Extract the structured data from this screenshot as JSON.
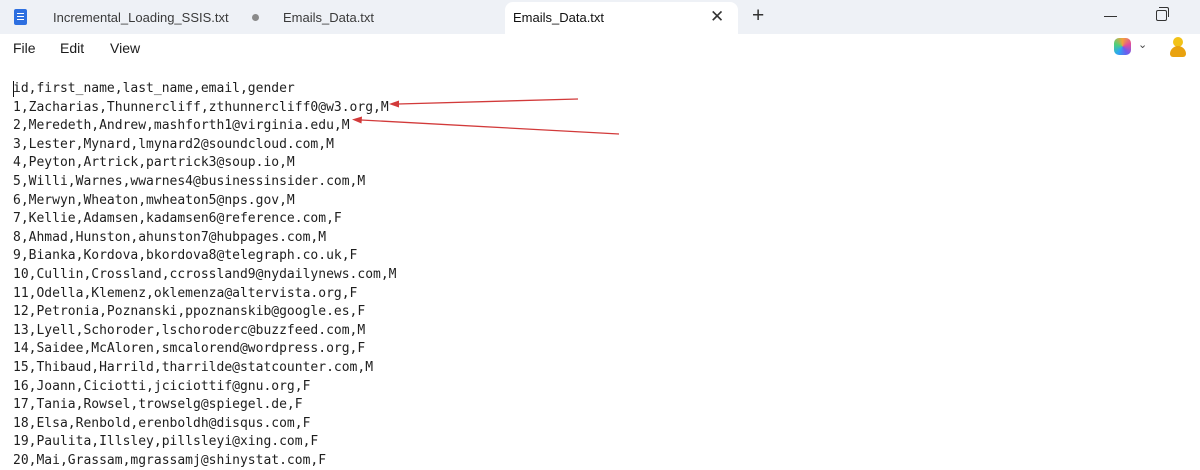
{
  "tabs": [
    {
      "label": "Incremental_Loading_SSIS.txt",
      "modified": true
    },
    {
      "label": "Emails_Data.txt"
    },
    {
      "label": "Emails_Data.txt",
      "active": true
    }
  ],
  "menu": [
    "File",
    "Edit",
    "View"
  ],
  "colors": {
    "annotation_arrow": "#d23a3a",
    "tab_accent": "#2d6fe0"
  },
  "icons": [
    "notepad-icon",
    "unsaved-dot-icon",
    "close-icon",
    "plus-icon",
    "minimize-icon",
    "maximize-icon",
    "copilot-icon",
    "chevron-down-icon",
    "avatar-icon"
  ],
  "file_lines": [
    "id,first_name,last_name,email,gender",
    "1,Zacharias,Thunnercliff,zthunnercliff0@w3.org,M",
    "2,Meredeth,Andrew,mashforth1@virginia.edu,M",
    "3,Lester,Mynard,lmynard2@soundcloud.com,M",
    "4,Peyton,Artrick,partrick3@soup.io,M",
    "5,Willi,Warnes,wwarnes4@businessinsider.com,M",
    "6,Merwyn,Wheaton,mwheaton5@nps.gov,M",
    "7,Kellie,Adamsen,kadamsen6@reference.com,F",
    "8,Ahmad,Hunston,ahunston7@hubpages.com,M",
    "9,Bianka,Kordova,bkordova8@telegraph.co.uk,F",
    "10,Cullin,Crossland,ccrossland9@nydailynews.com,M",
    "11,Odella,Klemenz,oklemenza@altervista.org,F",
    "12,Petronia,Poznanski,ppoznanskib@google.es,F",
    "13,Lyell,Schoroder,lschoroderc@buzzfeed.com,M",
    "14,Saidee,McAloren,smcalorend@wordpress.org,F",
    "15,Thibaud,Harrild,tharrilde@statcounter.com,M",
    "16,Joann,Ciciotti,jciciottif@gnu.org,F",
    "17,Tania,Rowsel,trowselg@spiegel.de,F",
    "18,Elsa,Renbold,erenboldh@disqus.com,F",
    "19,Paulita,Illsley,pillsleyi@xing.com,F",
    "20,Mai,Grassam,mgrassamj@shinystat.com,F"
  ]
}
